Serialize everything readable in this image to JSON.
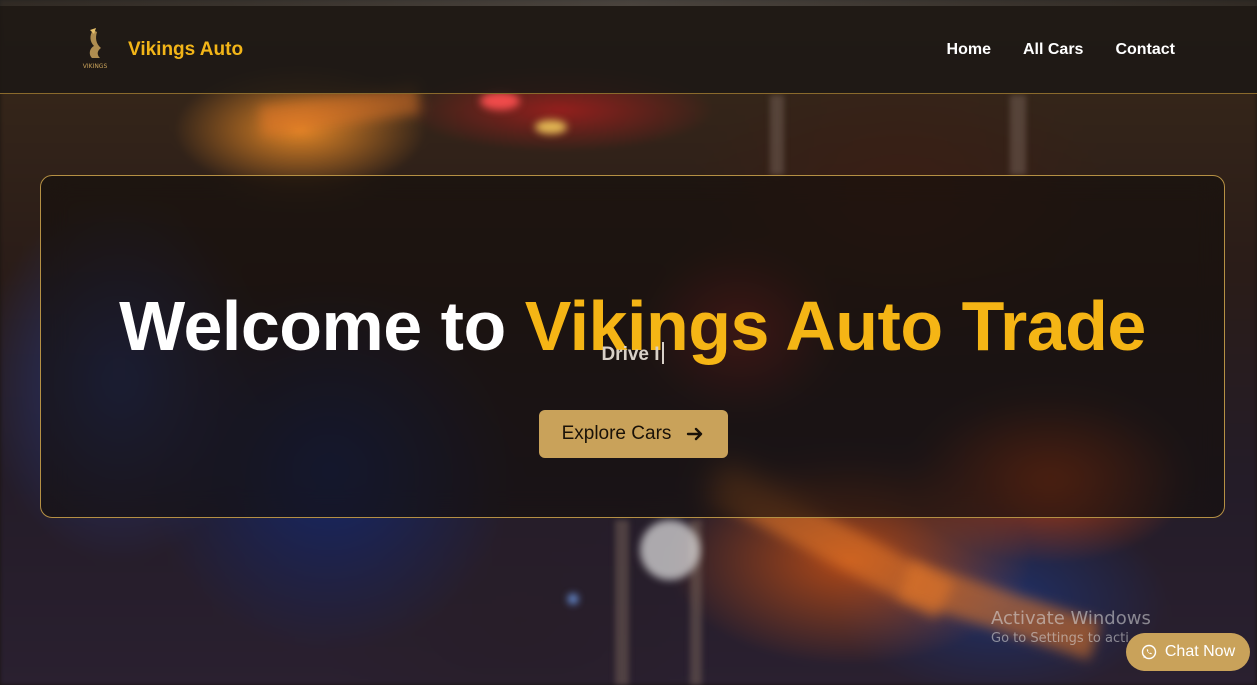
{
  "navbar": {
    "brand": "Vikings Auto",
    "logo_icon": "viking-logo-icon",
    "links": [
      {
        "label": "Home"
      },
      {
        "label": "All Cars"
      },
      {
        "label": "Contact"
      }
    ]
  },
  "hero": {
    "title_part1": "Welcome to",
    "title_part2": "Vikings Auto Trade",
    "typed_subtitle": "Drive I",
    "cta_label": "Explore Cars",
    "cta_icon": "arrow-right-icon"
  },
  "watermark": {
    "line1": "Activate Windows",
    "line2": "Go to Settings to acti"
  },
  "chat": {
    "label": "Chat Now",
    "icon": "whatsapp-icon"
  },
  "colors": {
    "accent_gold": "#f5b515",
    "button_gold": "#c9a25a",
    "border_gold": "#b59044"
  }
}
